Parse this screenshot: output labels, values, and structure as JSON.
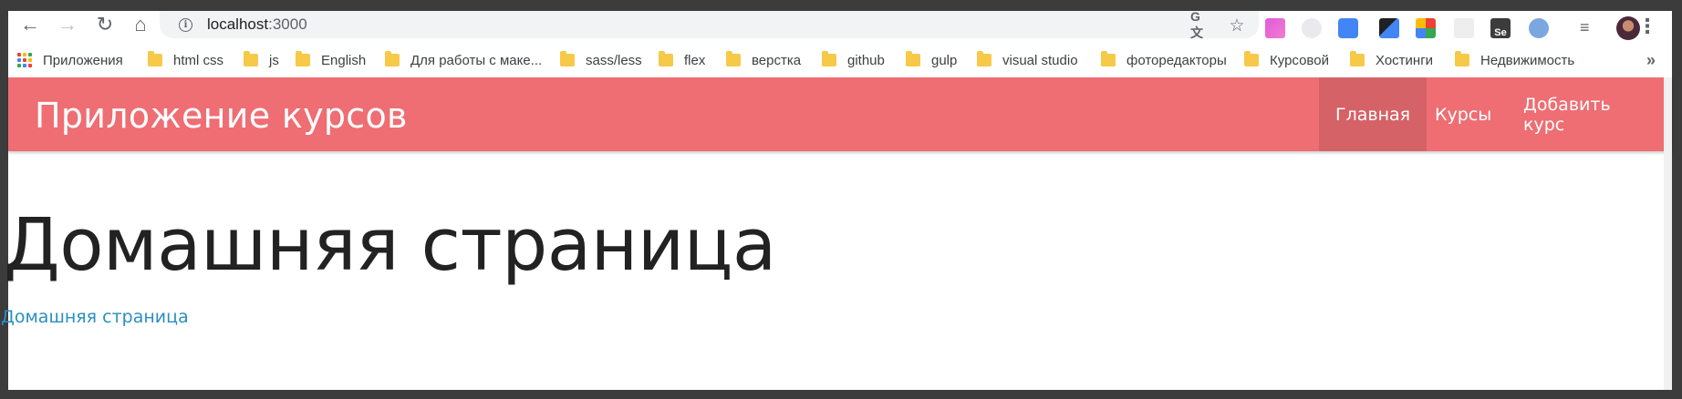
{
  "browser": {
    "url_host": "localhost",
    "url_port": ":3000",
    "bookmarks": [
      {
        "label": "Приложения",
        "icon": "apps-icon"
      },
      {
        "label": "html css",
        "icon": "folder-icon"
      },
      {
        "label": "js",
        "icon": "folder-icon"
      },
      {
        "label": "English",
        "icon": "folder-icon"
      },
      {
        "label": "Для работы с маке...",
        "icon": "folder-icon"
      },
      {
        "label": "sass/less",
        "icon": "folder-icon"
      },
      {
        "label": "flex",
        "icon": "folder-icon"
      },
      {
        "label": "верстка",
        "icon": "folder-icon"
      },
      {
        "label": "github",
        "icon": "folder-icon"
      },
      {
        "label": "gulp",
        "icon": "folder-icon"
      },
      {
        "label": "visual studio",
        "icon": "folder-icon"
      },
      {
        "label": "фоторедакторы",
        "icon": "folder-icon"
      },
      {
        "label": "Курсовой",
        "icon": "folder-icon"
      },
      {
        "label": "Хостинги",
        "icon": "folder-icon"
      },
      {
        "label": "Недвижимость",
        "icon": "folder-icon"
      }
    ],
    "more_bookmarks": "»"
  },
  "navbar": {
    "brand": "Приложение курсов",
    "background": "#ee6e73",
    "links": [
      {
        "label": "Главная",
        "active": true
      },
      {
        "label": "Курсы",
        "active": false
      },
      {
        "label": "Добавить курс",
        "active": false
      }
    ]
  },
  "main": {
    "heading": "Домашняя страница",
    "link_text": "Домашняя страница",
    "link_color": "#2a8fc0"
  }
}
